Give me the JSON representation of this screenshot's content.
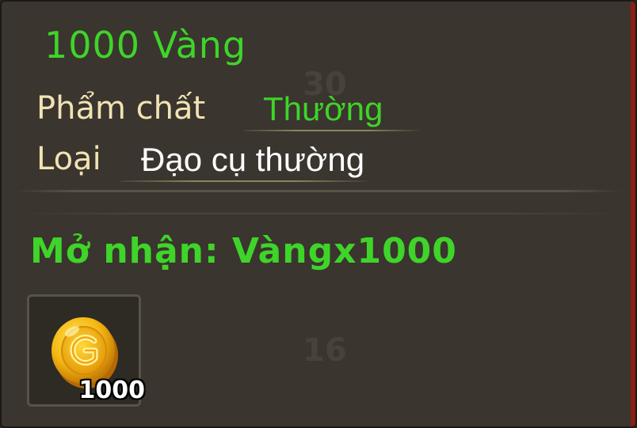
{
  "tooltip": {
    "title": "1000 Vàng",
    "quality_label": "Phẩm chất",
    "quality_value": "Thường",
    "type_label": "Loại",
    "type_value": "Đạo cụ thường",
    "reward_text": "Mở nhận: Vàngx1000",
    "item": {
      "icon": "gold-coin-icon",
      "quantity": "1000"
    }
  },
  "colors": {
    "title_green": "#3fd42a",
    "label_cream": "#f1e2b4",
    "value_white": "#ffffff",
    "panel_bg": "#3a352e"
  }
}
